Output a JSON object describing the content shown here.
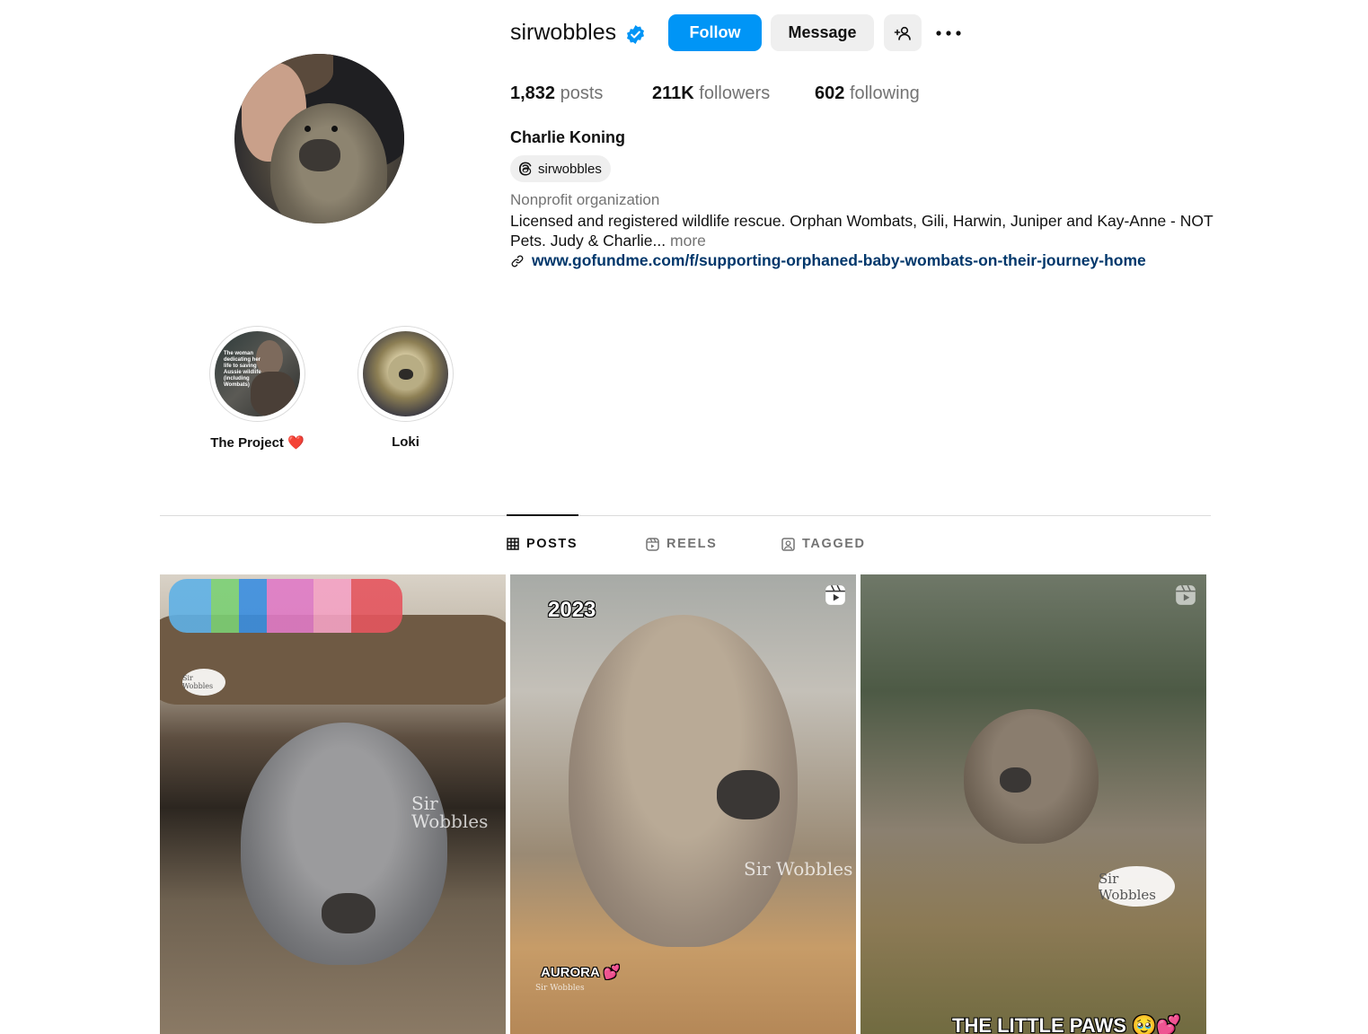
{
  "profile": {
    "username": "sirwobbles",
    "verified": true,
    "full_name": "Charlie Koning",
    "threads_handle": "sirwobbles",
    "category": "Nonprofit organization",
    "bio": "Licensed and registered wildlife rescue. Orphan Wombats, Gili, Harwin, Juniper and Kay-Anne - NOT Pets. Judy & Charlie...",
    "bio_more": "more",
    "link": "www.gofundme.com/f/supporting-orphaned-baby-wombats-on-their-journey-home"
  },
  "actions": {
    "follow_label": "Follow",
    "message_label": "Message"
  },
  "stats": {
    "posts_count": "1,832",
    "posts_label": "posts",
    "followers_count": "211K",
    "followers_label": "followers",
    "following_count": "602",
    "following_label": "following"
  },
  "highlights": [
    {
      "label": "The Project ❤️",
      "thumb_text": "The woman dedicating her life to saving Aussie wildlife (including Wombats)"
    },
    {
      "label": "Loki"
    }
  ],
  "tabs": [
    {
      "label": "POSTS",
      "active": true
    },
    {
      "label": "REELS",
      "active": false
    },
    {
      "label": "TAGGED",
      "active": false
    }
  ],
  "posts": [
    {
      "watermark": "Sir Wobbles",
      "bubble": "Sir Wobbles"
    },
    {
      "overlay_top": "2023",
      "overlay_bottom": "AURORA 💕",
      "watermark": "Sir Wobbles",
      "small_watermark": "Sir Wobbles",
      "is_reel": true
    },
    {
      "overlay_bottom": "THE LITTLE PAWS 🥹💕",
      "bubble": "Sir Wobbles",
      "is_reel": true
    }
  ],
  "colors": {
    "primary_button": "#0095f6",
    "secondary_button": "#efefef",
    "link": "#00376b",
    "muted_text": "#737373",
    "verified_badge": "#0095f6"
  },
  "icons": {
    "verified": "verified-badge-icon",
    "add_user": "add-user-icon",
    "more": "more-options-icon",
    "threads": "threads-icon",
    "link": "link-icon",
    "posts_tab": "grid-icon",
    "reels_tab": "reels-icon",
    "tagged_tab": "tagged-icon",
    "reel_overlay": "reel-icon"
  }
}
